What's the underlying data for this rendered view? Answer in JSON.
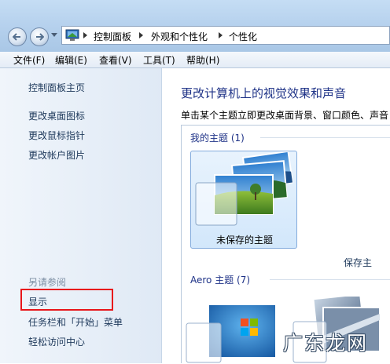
{
  "address_bar": {
    "crumbs": [
      "控制面板",
      "外观和个性化",
      "个性化"
    ]
  },
  "menu": [
    "文件(F)",
    "编辑(E)",
    "查看(V)",
    "工具(T)",
    "帮助(H)"
  ],
  "sidebar": {
    "links": [
      "控制面板主页",
      "更改桌面图标",
      "更改鼠标指针",
      "更改帐户图片"
    ],
    "see_also_label": "另请参阅",
    "see_also_links": [
      "显示",
      "任务栏和「开始」菜单",
      "轻松访问中心"
    ]
  },
  "main": {
    "heading": "更改计算机上的视觉效果和声音",
    "description": "单击某个主题立即更改桌面背景、窗口颜色、声音",
    "my_themes_label": "我的主题 (1)",
    "unsaved_theme_label": "未保存的主题",
    "save_theme_link": "保存主",
    "aero_themes_label": "Aero 主题 (7)"
  },
  "watermark": "广东龙网",
  "colors": {
    "heading": "#1e3287",
    "link": "#1e395b",
    "highlight_box": "#e8161b"
  }
}
